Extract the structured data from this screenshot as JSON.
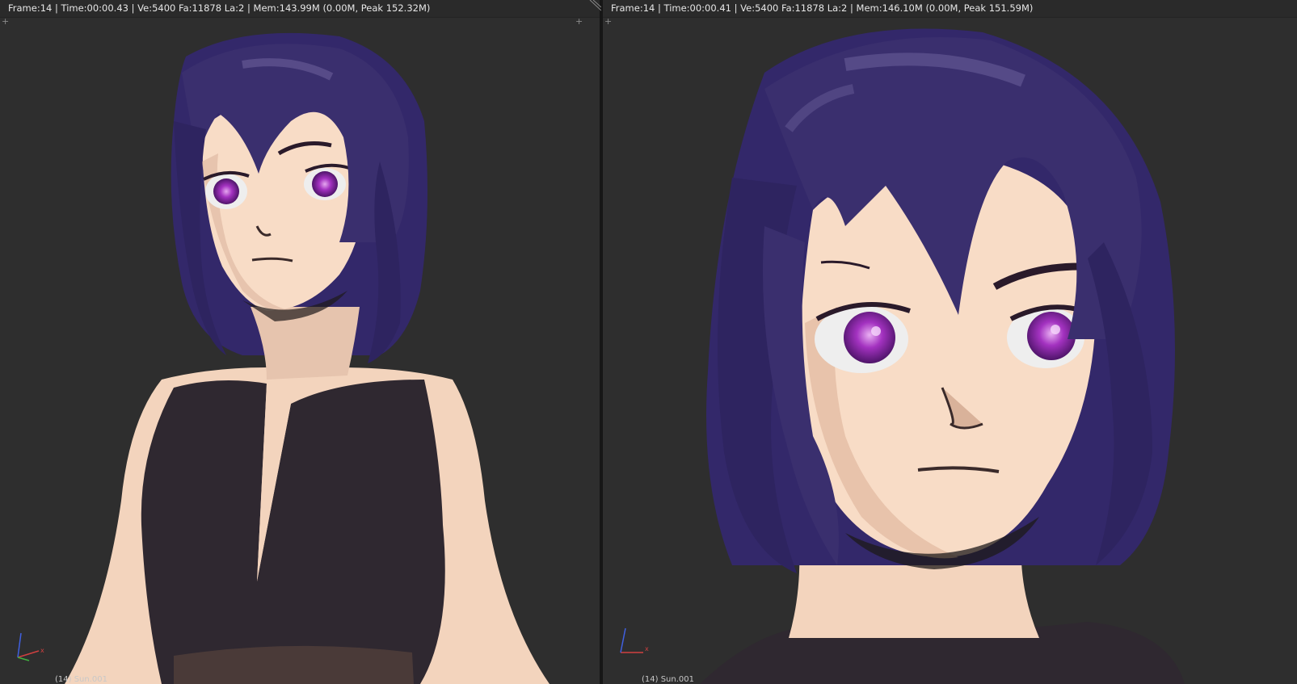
{
  "left_viewport": {
    "status": "Frame:14 | Time:00:00.43 | Ve:5400 Fa:11878 La:2 | Mem:143.99M (0.00M, Peak 152.32M)",
    "object_label": "(14) Sun.001"
  },
  "right_viewport": {
    "status": "Frame:14 | Time:00:00.41 | Ve:5400 Fa:11878 La:2 | Mem:146.10M (0.00M, Peak 151.59M)",
    "object_label": "(14) Sun.001"
  },
  "colors": {
    "viewport_bg": "#2e2e2e",
    "hair": "#3a2f6e",
    "skin": "#f8dcc6",
    "dress": "#2f2830",
    "eye": "#9b2bb5"
  }
}
